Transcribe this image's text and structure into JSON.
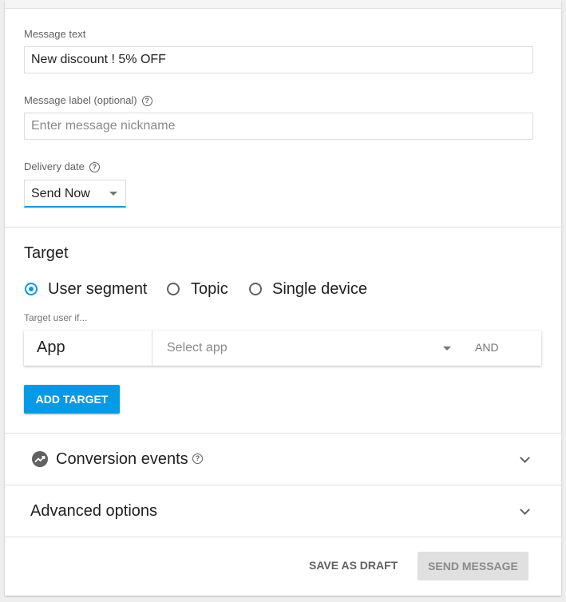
{
  "message": {
    "text_label": "Message text",
    "text_value": "New discount ! 5% OFF",
    "label_label": "Message label (optional)",
    "label_placeholder": "Enter message nickname",
    "delivery_label": "Delivery date",
    "delivery_value": "Send Now"
  },
  "target": {
    "heading": "Target",
    "options": [
      "User segment",
      "Topic",
      "Single device"
    ],
    "selected": "User segment",
    "condition_label": "Target user if...",
    "row": {
      "field": "App",
      "select_placeholder": "Select app",
      "and_label": "AND"
    },
    "add_button": "ADD TARGET"
  },
  "sections": {
    "conversion": "Conversion events",
    "advanced": "Advanced options"
  },
  "footer": {
    "save_draft": "SAVE AS DRAFT",
    "send": "SEND MESSAGE"
  },
  "colors": {
    "accent": "#039be5",
    "disabled_bg": "#e0e0e0"
  },
  "icons": {
    "help": "help-circle-icon",
    "dropdown": "caret-down-icon",
    "conversion": "trending-up-icon",
    "expand": "chevron-down-icon"
  }
}
